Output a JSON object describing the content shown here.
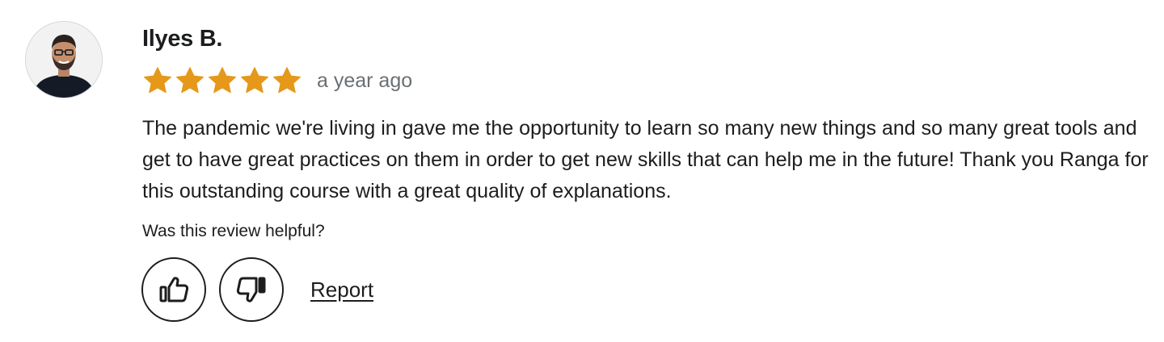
{
  "review": {
    "reviewer_name": "Ilyes B.",
    "rating": 5,
    "rating_max": 5,
    "time_ago": "a year ago",
    "body": "The pandemic we're living in gave me the opportunity to learn so many new things and so many great tools and get to have great practices on them in order to get new skills that can help me in the future! Thank you Ranga for this outstanding course with a great quality of explanations.",
    "helpful_question": "Was this review helpful?",
    "report_label": "Report"
  },
  "icons": {
    "thumbs_up": "thumbs-up-icon",
    "thumbs_down": "thumbs-down-icon",
    "star": "star-icon"
  },
  "colors": {
    "star": "#e59819",
    "text": "#1c1d1f",
    "muted": "#6a6f73"
  }
}
